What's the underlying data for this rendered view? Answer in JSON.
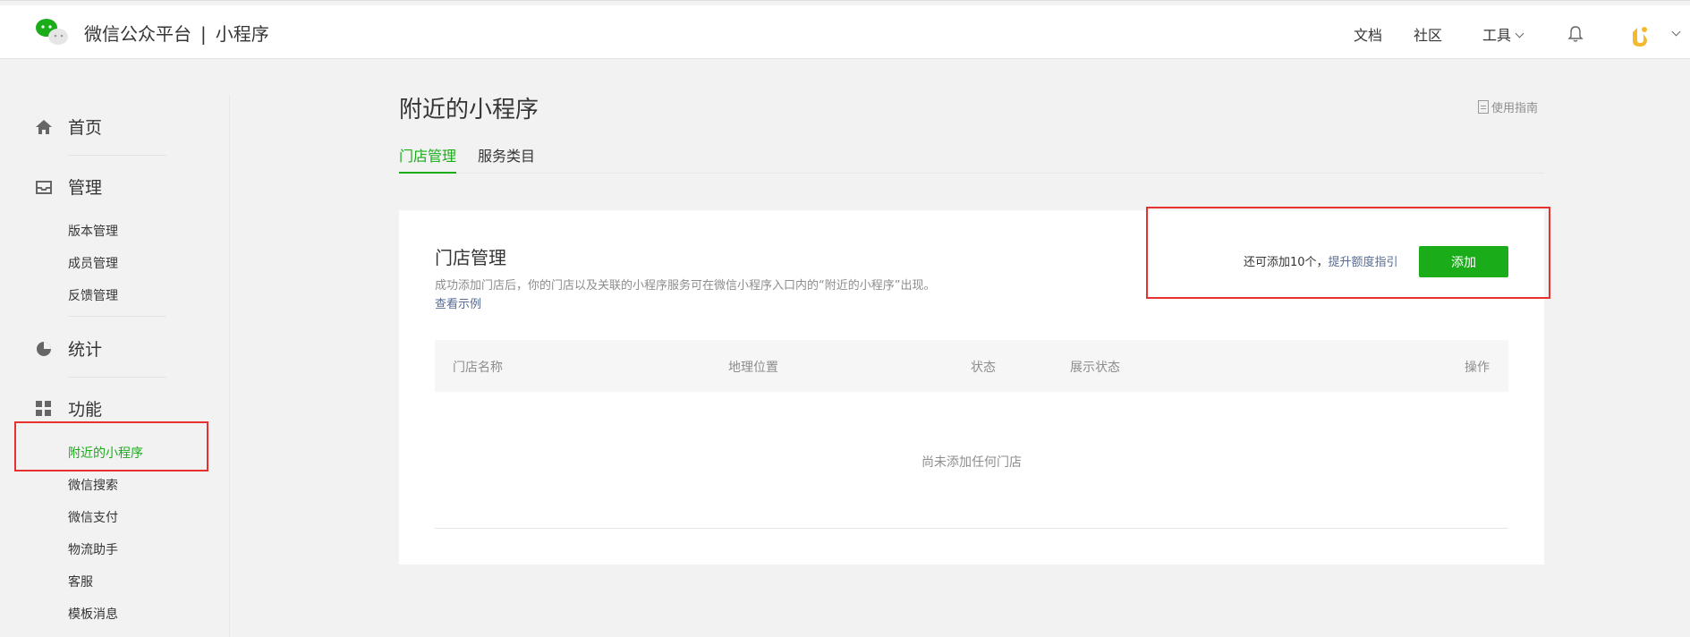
{
  "header": {
    "brand": "微信公众平台",
    "separator": "|",
    "product": "小程序",
    "nav": {
      "docs": "文档",
      "community": "社区",
      "tools": "工具"
    }
  },
  "sidebar": {
    "home": "首页",
    "manage": {
      "label": "管理",
      "items": [
        "版本管理",
        "成员管理",
        "反馈管理"
      ]
    },
    "stats": "统计",
    "features": {
      "label": "功能",
      "items": [
        "附近的小程序",
        "微信搜索",
        "微信支付",
        "物流助手",
        "客服",
        "模板消息"
      ]
    },
    "active_item": "附近的小程序"
  },
  "main": {
    "title": "附近的小程序",
    "guide_link": "使用指南",
    "tabs": [
      "门店管理",
      "服务类目"
    ],
    "active_tab": "门店管理",
    "card": {
      "title": "门店管理",
      "description": "成功添加门店后，你的门店以及关联的小程序服务可在微信小程序入口内的“附近的小程序”出现。",
      "example_link": "查看示例",
      "quota_text": "还可添加10个，",
      "quota_link": "提升额度指引",
      "add_button": "添加",
      "columns": [
        "门店名称",
        "地理位置",
        "状态",
        "展示状态",
        "操作"
      ],
      "empty_text": "尚未添加任何门店"
    }
  },
  "colors": {
    "accent": "#1aad19",
    "link": "#576b95",
    "highlight_box": "#e5322e"
  }
}
